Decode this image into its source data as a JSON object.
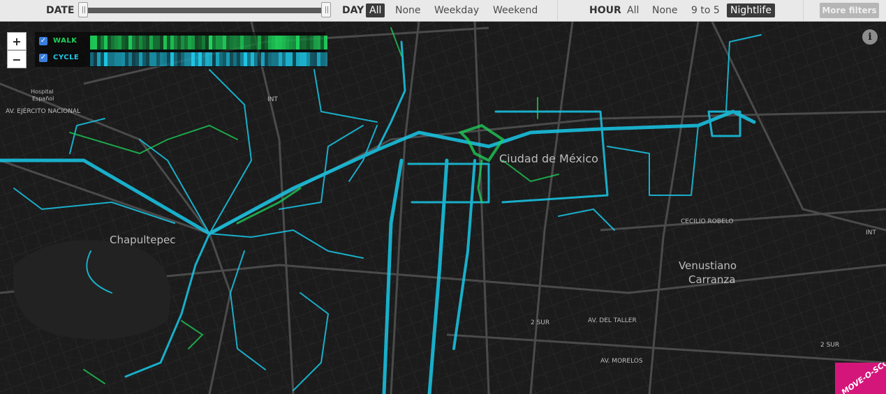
{
  "filters": {
    "date_label": "DATE",
    "day_label": "DAY",
    "day_options": [
      {
        "label": "All",
        "active": true
      },
      {
        "label": "None",
        "active": false
      },
      {
        "label": "Weekday",
        "active": false
      },
      {
        "label": "Weekend",
        "active": false
      }
    ],
    "hour_label": "HOUR",
    "hour_options": [
      {
        "label": "All",
        "active": false
      },
      {
        "label": "None",
        "active": false
      },
      {
        "label": "9 to 5",
        "active": false
      },
      {
        "label": "Nightlife",
        "active": true
      }
    ],
    "more_filters": "More filters",
    "date_range": {
      "start_fraction": 0.0,
      "end_fraction": 1.0
    }
  },
  "map_controls": {
    "zoom_in": "+",
    "zoom_out": "−",
    "info": "i"
  },
  "legend": {
    "walk": {
      "label": "WALK",
      "checked": true,
      "color": "#1fd35b"
    },
    "cycle": {
      "label": "CYCLE",
      "checked": true,
      "color": "#1fc6e6"
    }
  },
  "map_labels": {
    "chapultepec": "Chapultepec",
    "mexico": "Ciudad de México",
    "venustiano": "Venustiano",
    "carranza": "Carranza",
    "hospital": "Hospital",
    "espanol": "Español",
    "ejercito": "AV. EJÉRCITO NACIONAL",
    "morelos": "AV. MORELOS",
    "taller": "AV. DEL TALLER",
    "dos_sur": "2 SUR",
    "int": "INT",
    "cecilio": "CECILIO ROBELO"
  },
  "colors": {
    "walk": "#1fd35b",
    "cycle": "#19c8e8",
    "accent": "#d4167b",
    "map_bg": "#1b1b1b"
  },
  "logo": {
    "text": "MOVE-O-SCOPE"
  }
}
